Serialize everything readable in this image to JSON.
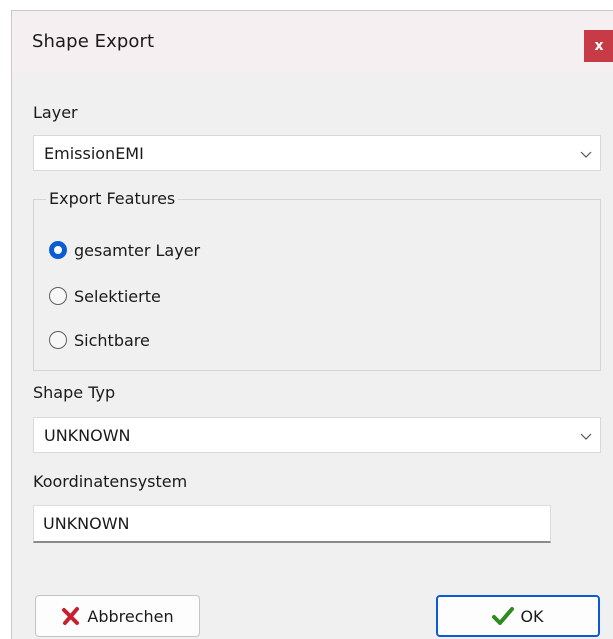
{
  "window": {
    "title": "Shape Export",
    "close_label": "x"
  },
  "layer": {
    "label": "Layer",
    "selected": "EmissionEMI"
  },
  "export_features": {
    "legend": "Export Features",
    "options": [
      {
        "label": "gesamter Layer",
        "checked": true
      },
      {
        "label": "Selektierte",
        "checked": false
      },
      {
        "label": "Sichtbare",
        "checked": false
      }
    ]
  },
  "shape_typ": {
    "label": "Shape Typ",
    "selected": "UNKNOWN"
  },
  "koordinatensystem": {
    "label": "Koordinatensystem",
    "value": "UNKNOWN"
  },
  "buttons": {
    "cancel_label": "Abbrechen",
    "ok_label": "OK"
  },
  "colors": {
    "accent": "#0b5cd4",
    "close": "#c63b45",
    "cancel_icon": "#c6202e",
    "ok_icon": "#2f8a1f"
  },
  "icons": {
    "cancel": "x-mark-icon",
    "ok": "checkmark-icon",
    "dropdown": "chevron-down-icon"
  }
}
